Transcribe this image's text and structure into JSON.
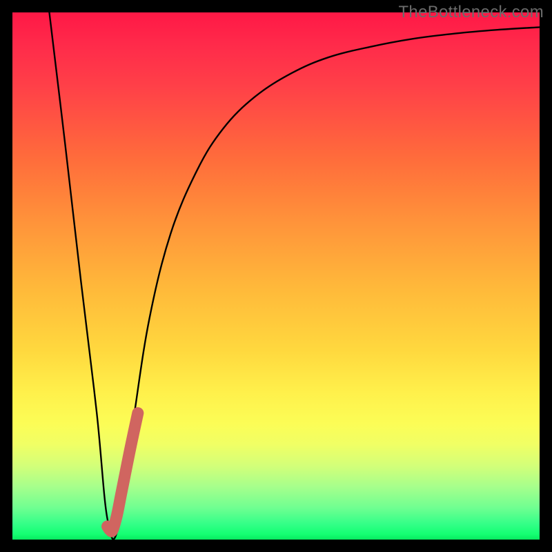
{
  "watermark": "TheBottleneck.com",
  "chart_data": {
    "type": "line",
    "title": "",
    "xlabel": "",
    "ylabel": "",
    "xlim": [
      0,
      100
    ],
    "ylim": [
      0,
      100
    ],
    "grid": false,
    "series": [
      {
        "name": "bottleneck-curve",
        "x": [
          7,
          10,
          13,
          16,
          18,
          20,
          23,
          26,
          30,
          35,
          40,
          46,
          53,
          60,
          68,
          76,
          84,
          92,
          100
        ],
        "values": [
          100,
          75,
          49,
          24,
          4,
          2,
          23,
          42,
          58,
          70,
          78,
          84,
          88.5,
          91.5,
          93.5,
          95,
          96,
          96.7,
          97.2
        ]
      },
      {
        "name": "highlight-segment",
        "x": [
          18.0,
          18.5,
          19.0,
          19.8,
          20.6,
          21.4,
          22.2,
          23.0,
          23.8
        ],
        "values": [
          2.5,
          1.8,
          1.8,
          4.5,
          8.5,
          12.5,
          16.5,
          20.3,
          24.0
        ]
      }
    ],
    "colors": {
      "curve": "#000000",
      "highlight": "#d06560",
      "gradient_top": "#ff1846",
      "gradient_bottom": "#08e85f"
    }
  }
}
